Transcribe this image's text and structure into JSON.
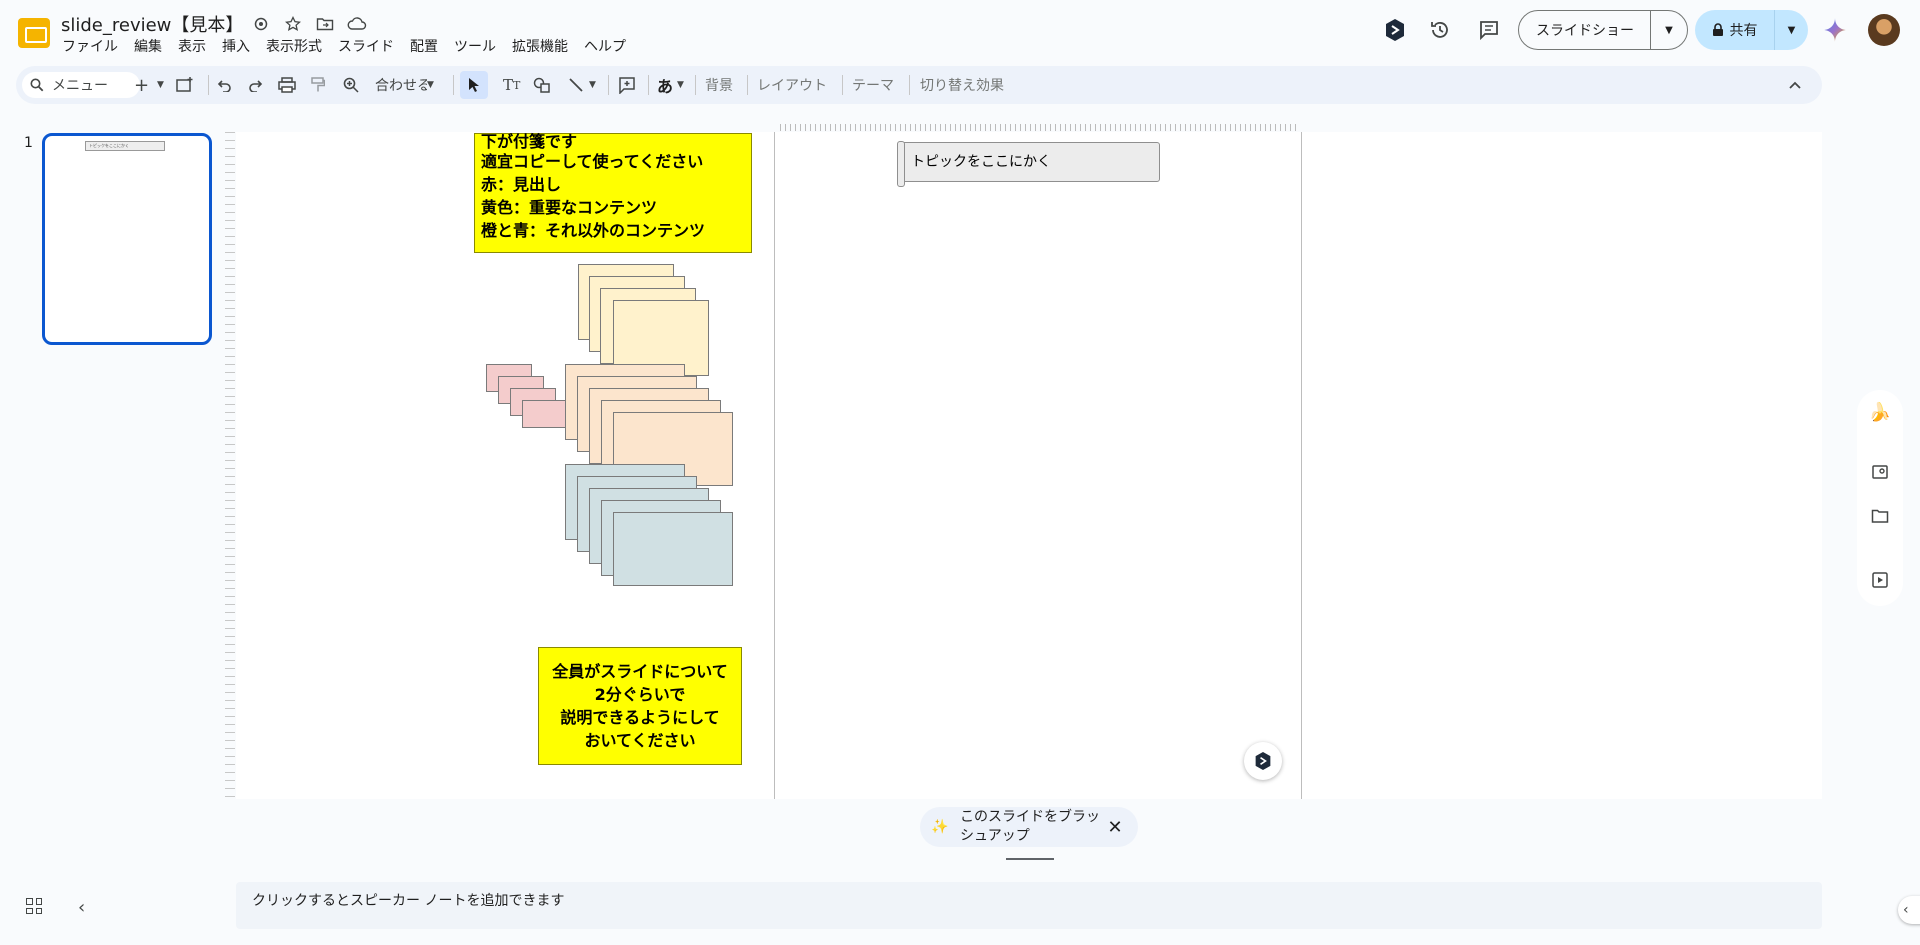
{
  "header": {
    "doc_title": "slide_review【見本】",
    "menu": [
      "ファイル",
      "編集",
      "表示",
      "挿入",
      "表示形式",
      "スライド",
      "配置",
      "ツール",
      "拡張機能",
      "ヘルプ"
    ],
    "slideshow_label": "スライドショー",
    "share_label": "共有"
  },
  "toolbar": {
    "search_placeholder": "メニュー",
    "zoom_label": "合わせる",
    "ime_label": "あ",
    "background_label": "背景",
    "layout_label": "レイアウト",
    "theme_label": "テーマ",
    "transition_label": "切り替え効果"
  },
  "filmstrip": {
    "slide_number": "1",
    "thumb_text": "トピックをここにかく"
  },
  "canvas": {
    "note_top_lines": [
      "下が付箋です",
      "適宜コピーして使ってください",
      "赤：見出し",
      "黄色：重要なコンテンツ",
      "橙と青：それ以外のコンテンツ"
    ],
    "note_bottom_lines": [
      "全員がスライドについて",
      "2分ぐらいで",
      "説明できるようにして",
      "おいてください"
    ],
    "topic_placeholder": "トピックをここにかく"
  },
  "bottom": {
    "gemini_chip_line1": "このスライドをブラッ",
    "gemini_chip_line2": "シュアップ",
    "speaker_notes_placeholder": "クリックするとスピーカー ノートを追加できます"
  },
  "colors": {
    "accent": "#0b57d0",
    "sticky_yellow": "#fff2cc",
    "sticky_orange": "#fce5cd",
    "sticky_blue": "#d0e0e3",
    "sticky_red": "#f4cccc",
    "note_yellow": "#ffff00"
  }
}
